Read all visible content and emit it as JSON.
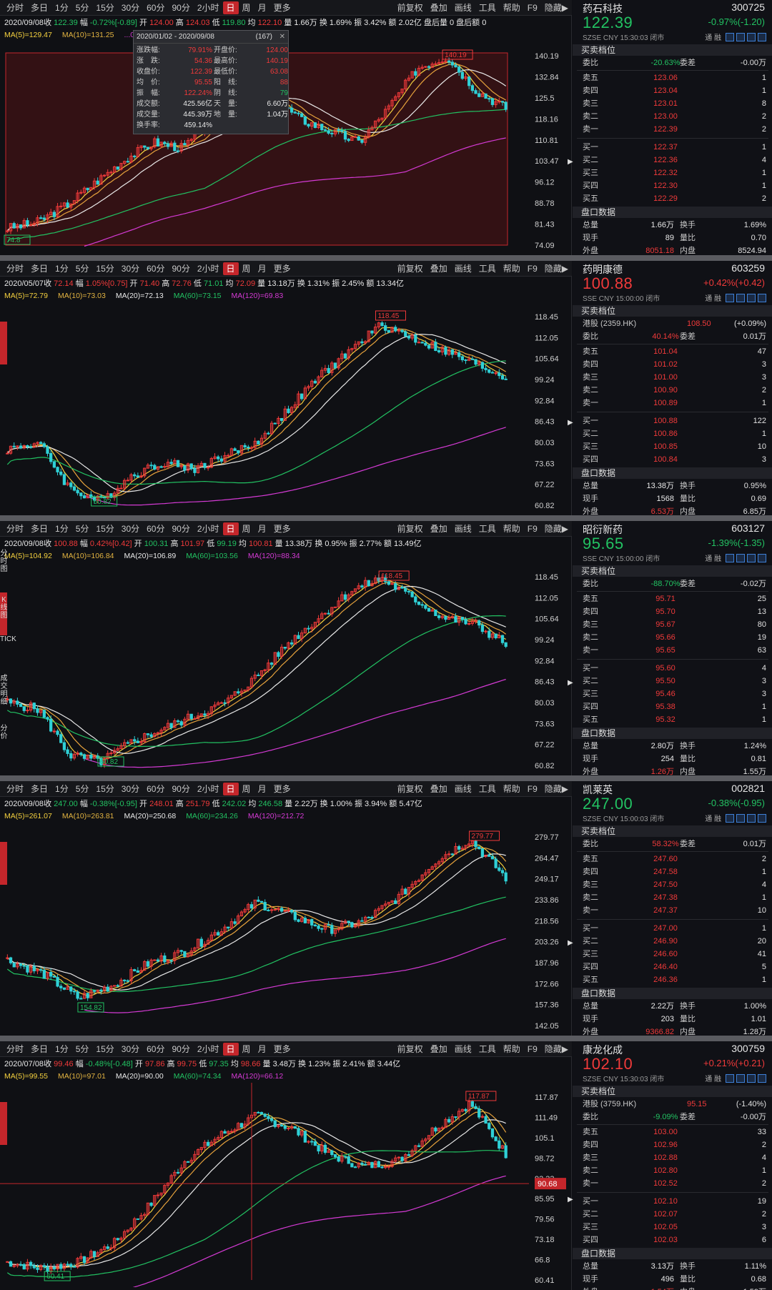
{
  "toolbar": {
    "left": [
      "分时",
      "多日",
      "1分",
      "5分",
      "15分",
      "30分",
      "60分",
      "90分",
      "2小时",
      "日",
      "周",
      "月",
      "更多"
    ],
    "active": "日",
    "right": [
      "前复权",
      "叠加",
      "画线",
      "工具",
      "帮助",
      "F9",
      "隐藏▶"
    ]
  },
  "panels": [
    {
      "id": "p1",
      "info": [
        [
          "2020/09/08",
          "wht"
        ],
        [
          "收 ",
          "wht"
        ],
        [
          "122.39",
          "grn"
        ],
        [
          " 幅 ",
          "wht"
        ],
        [
          "-0.72%[-0.89]",
          "grn"
        ],
        [
          " 开 ",
          "wht"
        ],
        [
          "124.00",
          "red"
        ],
        [
          " 高 ",
          "wht"
        ],
        [
          "124.03",
          "red"
        ],
        [
          " 低 ",
          "wht"
        ],
        [
          "119.80",
          "grn"
        ],
        [
          " 均 ",
          "wht"
        ],
        [
          "122.10",
          "red"
        ],
        [
          " 量 1.66万 换 1.69% 振 3.42% 额 2.02亿 盘后量 0 盘后额 0",
          "wht"
        ]
      ],
      "ma": [
        [
          "MA(5)=129.47",
          "yel"
        ],
        [
          "MA(10)=131.25",
          "gld"
        ],
        [
          "...02.89",
          "mag"
        ]
      ],
      "yticks": [
        "140.19",
        "132.84",
        "125.5",
        "118.16",
        "110.81",
        "103.47",
        "96.12",
        "88.78",
        "81.43",
        "74.09"
      ],
      "high_label": "140.19",
      "low_label": "74.8",
      "tooltip": {
        "range": "2020/01/02 - 2020/09/08",
        "count": "(167)",
        "rows": [
          [
            "涨跌幅:",
            "79.91%",
            "开盘价:",
            "124.00"
          ],
          [
            "涨　跌:",
            "54.36",
            "最高价:",
            "140.19"
          ],
          [
            "收盘价:",
            "122.39",
            "最低价:",
            "63.08"
          ],
          [
            "均　价:",
            "95.55",
            "阳　线:",
            "88"
          ],
          [
            "振　幅:",
            "122.24%",
            "阴　线:",
            "79"
          ],
          [
            "成交额:",
            "425.56亿",
            "天　量:",
            "6.60万"
          ],
          [
            "成交量:",
            "445.39万",
            "地　量:",
            "1.04万"
          ],
          [
            "换手率:",
            "459.14%",
            "",
            ""
          ]
        ]
      },
      "quote": {
        "name": "药石科技",
        "code": "300725",
        "price": "122.39",
        "price_color": "grn",
        "chg": "-0.97%(-1.20)",
        "chg_color": "grn",
        "meta": "SZSE  CNY  15:30:03  闭市",
        "weibi": [
          "委比",
          "-20.63%",
          "委差",
          "-0.00万"
        ],
        "sell": [
          [
            "卖五",
            "123.06",
            "1"
          ],
          [
            "卖四",
            "123.04",
            "1"
          ],
          [
            "卖三",
            "123.01",
            "8"
          ],
          [
            "卖二",
            "123.00",
            "2"
          ],
          [
            "卖一",
            "122.39",
            "2"
          ]
        ],
        "buy": [
          [
            "买一",
            "122.37",
            "1"
          ],
          [
            "买二",
            "122.36",
            "4"
          ],
          [
            "买三",
            "122.32",
            "1"
          ],
          [
            "买四",
            "122.30",
            "1"
          ],
          [
            "买五",
            "122.29",
            "2"
          ]
        ],
        "pan": [
          [
            "总量",
            "1.66万",
            "换手",
            "1.69%"
          ],
          [
            "现手",
            "89",
            "量比",
            "0.70"
          ],
          [
            "外盘",
            "8051.18",
            "内盘",
            "8524.94"
          ]
        ]
      }
    },
    {
      "id": "p2",
      "info": [
        [
          "2020/05/07",
          "wht"
        ],
        [
          "收 ",
          "wht"
        ],
        [
          "72.14",
          "red"
        ],
        [
          " 幅 ",
          "wht"
        ],
        [
          "1.05%[0.75]",
          "red"
        ],
        [
          " 开 ",
          "wht"
        ],
        [
          "71.40",
          "red"
        ],
        [
          " 高 ",
          "wht"
        ],
        [
          "72.76",
          "red"
        ],
        [
          " 低 ",
          "wht"
        ],
        [
          "71.01",
          "grn"
        ],
        [
          " 均 ",
          "wht"
        ],
        [
          "72.09",
          "red"
        ],
        [
          " 量 13.18万 换 1.31% 振 2.45% 额 13.34亿",
          "wht"
        ]
      ],
      "ma": [
        [
          "MA(5)=72.79",
          "yel"
        ],
        [
          "MA(10)=73.03",
          "gld"
        ],
        [
          "MA(20)=72.13",
          "wht"
        ],
        [
          "MA(60)=73.15",
          "grn"
        ],
        [
          "MA(120)=69.83",
          "mag"
        ]
      ],
      "yticks": [
        "118.45",
        "112.05",
        "105.64",
        "99.24",
        "92.84",
        "86.43",
        "80.03",
        "73.63",
        "67.22",
        "60.82"
      ],
      "high_label": "118.45",
      "low_label": "60.82",
      "quote": {
        "name": "药明康德",
        "code": "603259",
        "price": "100.88",
        "price_color": "red",
        "chg": "+0.42%(+0.42)",
        "chg_color": "red",
        "meta": "SSE  CNY  15:00:00  闭市",
        "hk": [
          "港股 (2359.HK)",
          "108.50",
          "(+0.09%)"
        ],
        "weibi": [
          "委比",
          "40.14%",
          "委差",
          "0.01万"
        ],
        "sell": [
          [
            "卖五",
            "101.04",
            "47"
          ],
          [
            "卖四",
            "101.02",
            "3"
          ],
          [
            "卖三",
            "101.00",
            "3"
          ],
          [
            "卖二",
            "100.90",
            "2"
          ],
          [
            "卖一",
            "100.89",
            "1"
          ]
        ],
        "buy": [
          [
            "买一",
            "100.88",
            "122"
          ],
          [
            "买二",
            "100.86",
            "1"
          ],
          [
            "买三",
            "100.85",
            "10"
          ],
          [
            "买四",
            "100.84",
            "3"
          ]
        ],
        "pan": [
          [
            "总量",
            "13.38万",
            "换手",
            "0.95%"
          ],
          [
            "现手",
            "1568",
            "量比",
            "0.69"
          ],
          [
            "外盘",
            "6.53万",
            "内盘",
            "6.85万"
          ]
        ]
      }
    },
    {
      "id": "p3",
      "info": [
        [
          "2020/09/08",
          "wht"
        ],
        [
          "收 ",
          "wht"
        ],
        [
          "100.88",
          "red"
        ],
        [
          " 幅 ",
          "wht"
        ],
        [
          "0.42%[0.42]",
          "red"
        ],
        [
          " 开 ",
          "wht"
        ],
        [
          "100.31",
          "grn"
        ],
        [
          " 高 ",
          "wht"
        ],
        [
          "101.97",
          "red"
        ],
        [
          " 低 ",
          "wht"
        ],
        [
          "99.19",
          "grn"
        ],
        [
          " 均 ",
          "wht"
        ],
        [
          "100.81",
          "red"
        ],
        [
          " 量 13.38万 换 0.95% 振 2.77% 额 13.49亿",
          "wht"
        ]
      ],
      "ma": [
        [
          "MA(5)=104.92",
          "yel"
        ],
        [
          "MA(10)=106.84",
          "gld"
        ],
        [
          "MA(20)=106.89",
          "wht"
        ],
        [
          "MA(60)=103.56",
          "grn"
        ],
        [
          "MA(120)=88.34",
          "mag"
        ]
      ],
      "yticks": [
        "118.45",
        "112.05",
        "105.64",
        "99.24",
        "92.84",
        "86.43",
        "80.03",
        "73.63",
        "67.22",
        "60.82"
      ],
      "high_label": "118.45",
      "low_label": "60.82",
      "sidetext": [
        "分时图",
        "K线图",
        "TICK",
        "成交明细",
        "分价"
      ],
      "quote": {
        "name": "昭衍新药",
        "code": "603127",
        "price": "95.65",
        "price_color": "grn",
        "chg": "-1.39%(-1.35)",
        "chg_color": "grn",
        "meta": "SSE  CNY  15:00:00  闭市",
        "weibi": [
          "委比",
          "-88.70%",
          "委差",
          "-0.02万"
        ],
        "sell": [
          [
            "卖五",
            "95.71",
            "25"
          ],
          [
            "卖四",
            "95.70",
            "13"
          ],
          [
            "卖三",
            "95.67",
            "80"
          ],
          [
            "卖二",
            "95.66",
            "19"
          ],
          [
            "卖一",
            "95.65",
            "63"
          ]
        ],
        "buy": [
          [
            "买一",
            "95.60",
            "4"
          ],
          [
            "买二",
            "95.50",
            "3"
          ],
          [
            "买三",
            "95.46",
            "3"
          ],
          [
            "买四",
            "95.38",
            "1"
          ],
          [
            "买五",
            "95.32",
            "1"
          ]
        ],
        "pan": [
          [
            "总量",
            "2.80万",
            "换手",
            "1.24%"
          ],
          [
            "现手",
            "254",
            "量比",
            "0.81"
          ],
          [
            "外盘",
            "1.26万",
            "内盘",
            "1.55万"
          ]
        ]
      }
    },
    {
      "id": "p4",
      "info": [
        [
          "2020/09/08",
          "wht"
        ],
        [
          "收 ",
          "wht"
        ],
        [
          "247.00",
          "grn"
        ],
        [
          " 幅 ",
          "wht"
        ],
        [
          "-0.38%[-0.95]",
          "grn"
        ],
        [
          " 开 ",
          "wht"
        ],
        [
          "248.01",
          "red"
        ],
        [
          " 高 ",
          "wht"
        ],
        [
          "251.79",
          "red"
        ],
        [
          " 低 ",
          "wht"
        ],
        [
          "242.02",
          "grn"
        ],
        [
          " 均 ",
          "wht"
        ],
        [
          "246.58",
          "grn"
        ],
        [
          " 量 2.22万 换 1.00% 振 3.94% 额 5.47亿",
          "wht"
        ]
      ],
      "ma": [
        [
          "MA(5)=261.07",
          "yel"
        ],
        [
          "MA(10)=263.81",
          "gld"
        ],
        [
          "MA(20)=250.68",
          "wht"
        ],
        [
          "MA(60)=234.26",
          "grn"
        ],
        [
          "MA(120)=212.72",
          "mag"
        ]
      ],
      "yticks": [
        "279.77",
        "264.47",
        "249.17",
        "233.86",
        "218.56",
        "203.26",
        "187.96",
        "172.66",
        "157.36",
        "142.05"
      ],
      "high_label": "279.77",
      "low_label": "154.82",
      "quote": {
        "name": "凯莱英",
        "code": "002821",
        "price": "247.00",
        "price_color": "grn",
        "chg": "-0.38%(-0.95)",
        "chg_color": "grn",
        "meta": "SZSE  CNY  15:00:03  闭市",
        "weibi": [
          "委比",
          "58.32%",
          "委差",
          "0.01万"
        ],
        "sell": [
          [
            "卖五",
            "247.60",
            "2"
          ],
          [
            "卖四",
            "247.58",
            "1"
          ],
          [
            "卖三",
            "247.50",
            "4"
          ],
          [
            "卖二",
            "247.38",
            "1"
          ],
          [
            "卖一",
            "247.37",
            "10"
          ]
        ],
        "buy": [
          [
            "买一",
            "247.00",
            "1"
          ],
          [
            "买二",
            "246.90",
            "20"
          ],
          [
            "买三",
            "246.60",
            "41"
          ],
          [
            "买四",
            "246.40",
            "5"
          ],
          [
            "买五",
            "246.36",
            "1"
          ]
        ],
        "pan": [
          [
            "总量",
            "2.22万",
            "换手",
            "1.00%"
          ],
          [
            "现手",
            "203",
            "量比",
            "1.01"
          ],
          [
            "外盘",
            "9366.82",
            "内盘",
            "1.28万"
          ]
        ]
      }
    },
    {
      "id": "p5",
      "info": [
        [
          "2020/07/08",
          "wht"
        ],
        [
          "收 ",
          "wht"
        ],
        [
          "99.46",
          "red"
        ],
        [
          " 幅 ",
          "wht"
        ],
        [
          "-0.48%[-0.48]",
          "grn"
        ],
        [
          " 开 ",
          "wht"
        ],
        [
          "97.86",
          "red"
        ],
        [
          " 高 ",
          "wht"
        ],
        [
          "99.75",
          "red"
        ],
        [
          " 低 ",
          "wht"
        ],
        [
          "97.35",
          "grn"
        ],
        [
          " 均 ",
          "wht"
        ],
        [
          "98.66",
          "red"
        ],
        [
          " 量 3.48万 换 1.23% 振 2.41% 额 3.44亿",
          "wht"
        ]
      ],
      "ma": [
        [
          "MA(5)=99.55",
          "yel"
        ],
        [
          "MA(10)=97.01",
          "gld"
        ],
        [
          "MA(20)=90.00",
          "wht"
        ],
        [
          "MA(60)=74.34",
          "grn"
        ],
        [
          "MA(120)=66.12",
          "mag"
        ]
      ],
      "yticks": [
        "117.87",
        "111.49",
        "105.1",
        "98.72",
        "92.33",
        "85.95",
        "79.56",
        "73.18",
        "66.8",
        "60.41"
      ],
      "high_label": "117.87",
      "low_label": "60.41",
      "cross_label": "90.68",
      "quote": {
        "name": "康龙化成",
        "code": "300759",
        "price": "102.10",
        "price_color": "red",
        "chg": "+0.21%(+0.21)",
        "chg_color": "red",
        "meta": "SZSE  CNY  15:30:03  闭市",
        "hk": [
          "港股 (3759.HK)",
          "95.15",
          "(-1.40%)"
        ],
        "weibi": [
          "委比",
          "-9.09%",
          "委差",
          "-0.00万"
        ],
        "sell": [
          [
            "卖五",
            "103.00",
            "33"
          ],
          [
            "卖四",
            "102.96",
            "2"
          ],
          [
            "卖三",
            "102.88",
            "4"
          ],
          [
            "卖二",
            "102.80",
            "1"
          ],
          [
            "卖一",
            "102.52",
            "2"
          ]
        ],
        "buy": [
          [
            "买一",
            "102.10",
            "19"
          ],
          [
            "买二",
            "102.07",
            "2"
          ],
          [
            "买三",
            "102.05",
            "3"
          ],
          [
            "买四",
            "102.03",
            "6"
          ]
        ],
        "pan": [
          [
            "总量",
            "3.13万",
            "换手",
            "1.11%"
          ],
          [
            "现手",
            "496",
            "量比",
            "0.68"
          ],
          [
            "外盘",
            "1.54万",
            "内盘",
            "1.59万"
          ]
        ]
      }
    }
  ],
  "labels": {
    "quote_section": "买卖档位",
    "pan_section": "盘口数据",
    "tongrong": "通  融"
  },
  "chart_data": [
    {
      "type": "candlestick",
      "name": "药石科技",
      "high": 140.19,
      "low": 74.8,
      "ylim": [
        74.09,
        140.19
      ],
      "path": [
        80,
        82,
        88,
        96,
        104,
        110,
        108,
        118,
        128,
        126,
        118,
        114,
        110,
        122,
        136,
        140,
        128,
        122
      ]
    },
    {
      "type": "candlestick",
      "name": "药明康德",
      "high": 118.45,
      "low": 60.82,
      "ylim": [
        60.82,
        118.45
      ],
      "path": [
        78,
        80,
        66,
        62,
        70,
        74,
        72,
        76,
        80,
        90,
        100,
        108,
        116,
        112,
        108,
        104,
        100
      ]
    },
    {
      "type": "candlestick",
      "name": "昭衍新药",
      "high": 118.45,
      "low": 60.82,
      "ylim": [
        60.82,
        118.45
      ],
      "path": [
        80,
        78,
        64,
        62,
        68,
        72,
        76,
        80,
        88,
        98,
        106,
        114,
        118,
        112,
        106,
        104,
        98
      ]
    },
    {
      "type": "candlestick",
      "name": "凯莱英",
      "high": 279.77,
      "low": 154.82,
      "ylim": [
        142.05,
        279.77
      ],
      "path": [
        190,
        180,
        162,
        172,
        188,
        196,
        212,
        232,
        222,
        212,
        218,
        236,
        262,
        278,
        250
      ]
    },
    {
      "type": "candlestick",
      "name": "康龙化成",
      "high": 117.87,
      "low": 60.41,
      "ylim": [
        60.41,
        117.87
      ],
      "path": [
        66,
        64,
        66,
        72,
        84,
        98,
        106,
        112,
        108,
        100,
        96,
        98,
        108,
        116,
        100
      ]
    }
  ]
}
